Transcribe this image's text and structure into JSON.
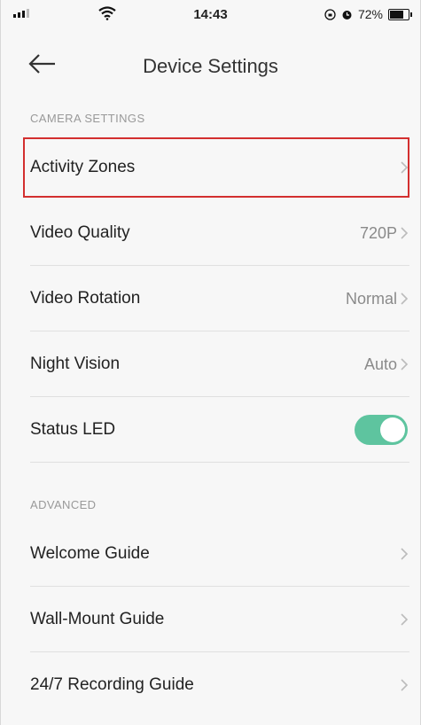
{
  "status_bar": {
    "time": "14:43",
    "battery_percent": "72%",
    "icons": [
      "signal-icon",
      "wifi-icon",
      "orientation-lock-icon",
      "alarm-icon",
      "battery-icon"
    ]
  },
  "header": {
    "title": "Device Settings",
    "back_icon": "arrow-left-icon"
  },
  "sections": {
    "camera_settings": {
      "title": "CAMERA SETTINGS",
      "items": [
        {
          "label": "Activity Zones",
          "value": "",
          "highlighted": true
        },
        {
          "label": "Video Quality",
          "value": "720P"
        },
        {
          "label": "Video Rotation",
          "value": "Normal"
        },
        {
          "label": "Night Vision",
          "value": "Auto"
        },
        {
          "label": "Status LED",
          "toggle": true,
          "toggle_on": true
        }
      ]
    },
    "advanced": {
      "title": "ADVANCED",
      "items": [
        {
          "label": "Welcome Guide"
        },
        {
          "label": "Wall-Mount Guide"
        },
        {
          "label": "24/7 Recording Guide"
        }
      ]
    }
  },
  "colors": {
    "toggle_on": "#5ec49f",
    "highlight_border": "#d32f2f",
    "background": "#f7f7f7"
  }
}
